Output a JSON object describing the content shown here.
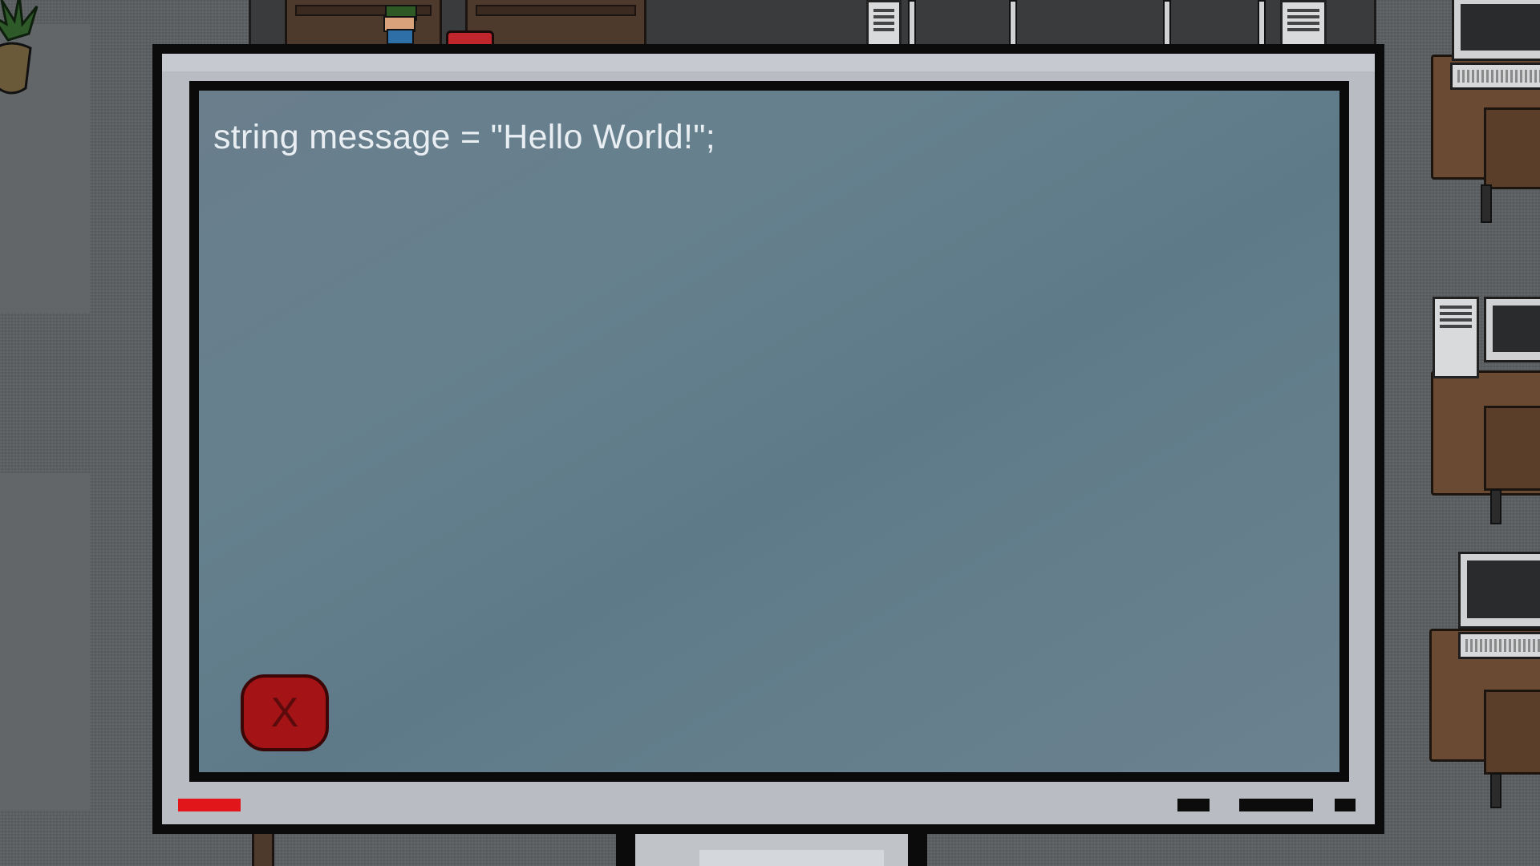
{
  "code_window": {
    "code_line": "string message = \"Hello World!\";",
    "close_label": "X"
  },
  "colors": {
    "screen": "#66808e",
    "bezel": "#b9bcc2",
    "close_button": "#a41316",
    "power_led": "#e1161b"
  }
}
